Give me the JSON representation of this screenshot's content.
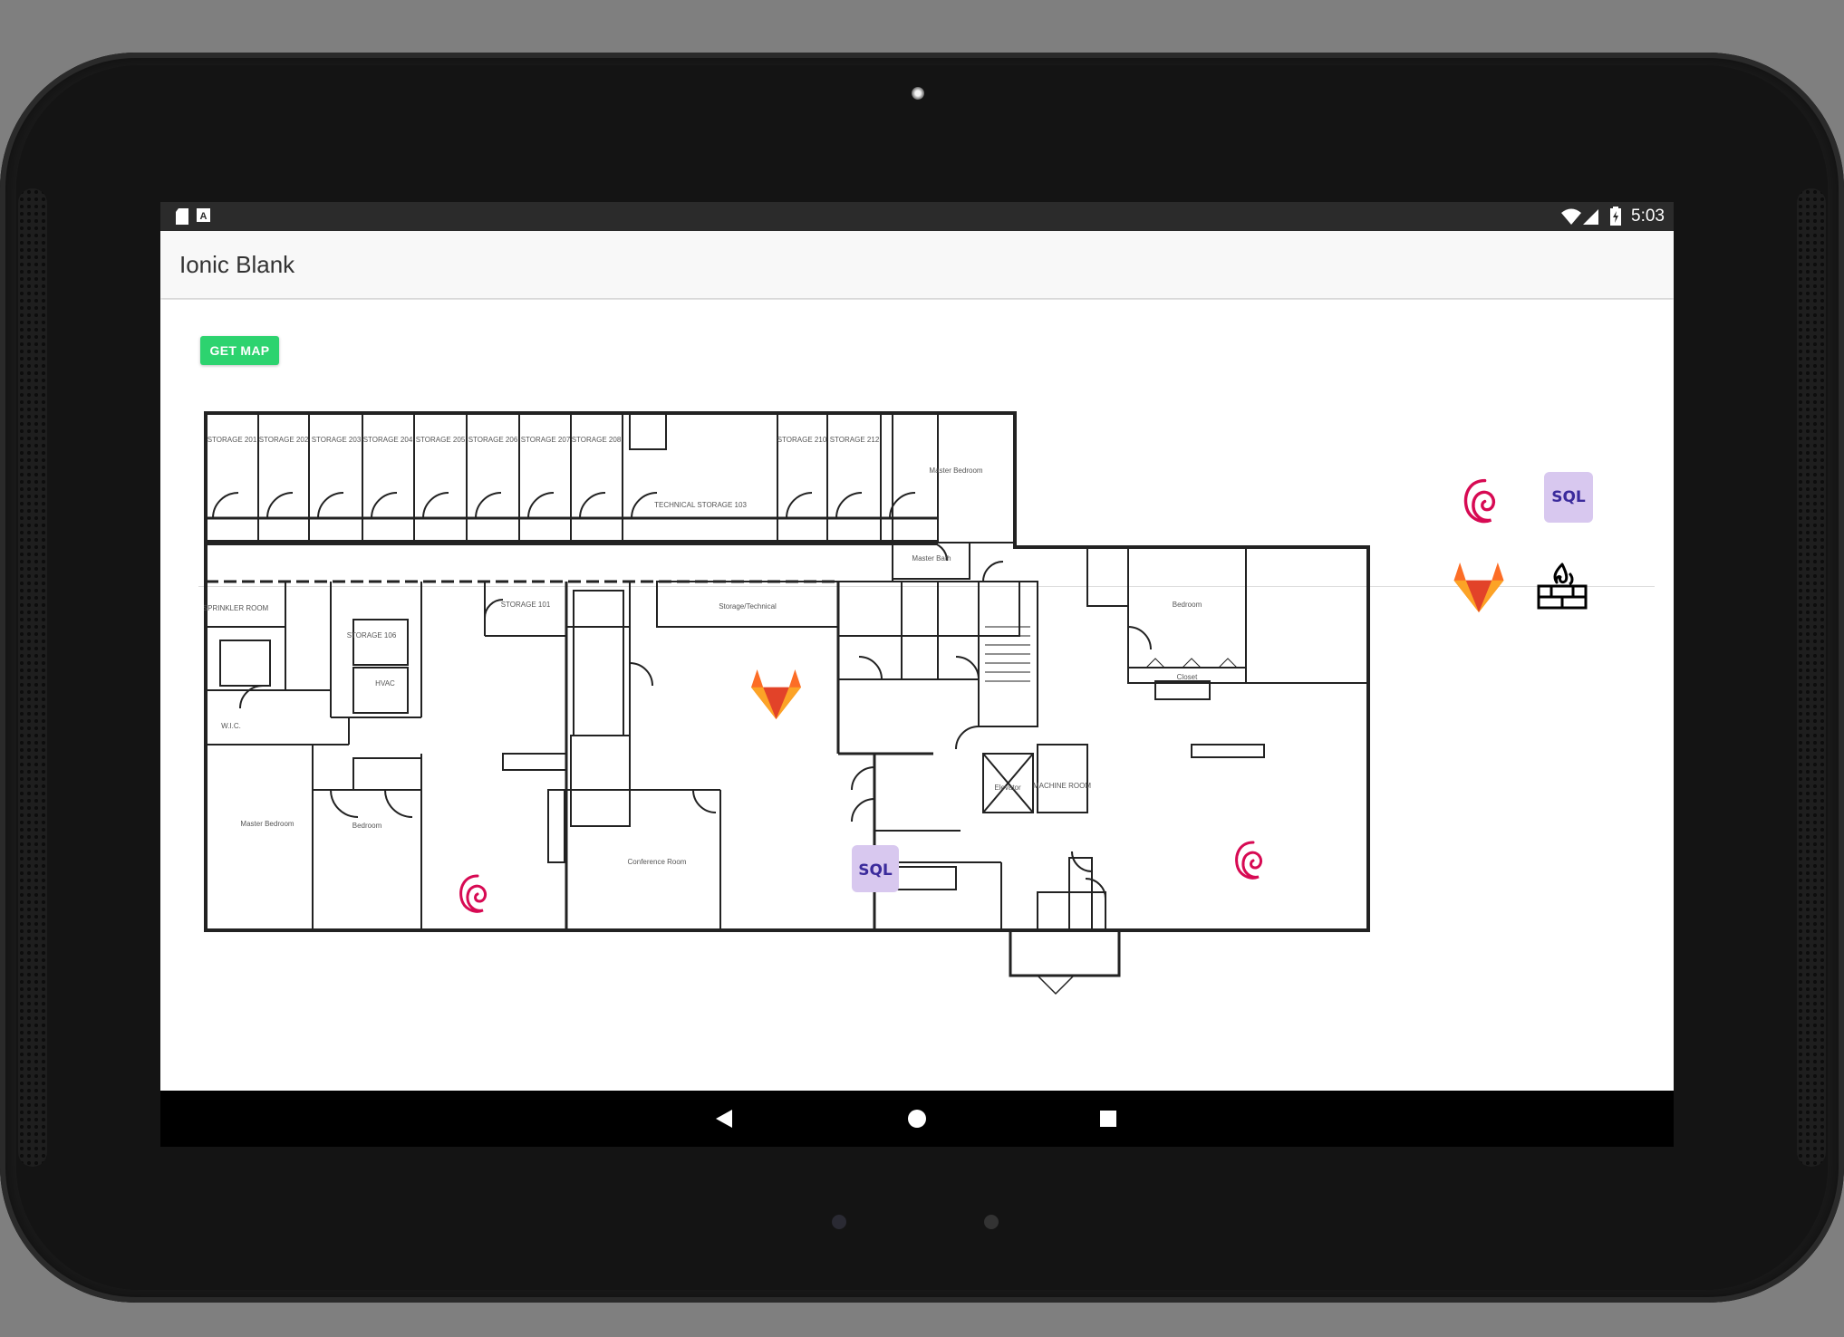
{
  "status_bar": {
    "left_icons": [
      "sd-card-icon",
      "a-notification-icon"
    ],
    "right_icons": [
      "wifi-icon",
      "cell-signal-icon",
      "battery-icon"
    ],
    "time": "5:03"
  },
  "header": {
    "title": "Ionic Blank"
  },
  "content": {
    "get_map_label": "GET MAP"
  },
  "floor_plan": {
    "room_labels": {
      "storage_201": "STORAGE 201",
      "storage_202": "STORAGE 202",
      "storage_203": "STORAGE 203",
      "storage_204": "STORAGE 204",
      "storage_205": "STORAGE 205",
      "storage_206": "STORAGE 206",
      "storage_207": "STORAGE 207",
      "storage_208": "STORAGE 208",
      "storage_210": "STORAGE 210",
      "storage_212": "STORAGE 212",
      "technical_storage": "TECHNICAL STORAGE 103",
      "master_bedroom_top": "Master Bedroom",
      "master_bath": "Master Bath",
      "sprinkler_room": "SPRINKLER ROOM",
      "storage_106": "STORAGE 106",
      "storage_101": "STORAGE 101",
      "storage_technical": "Storage/Technical",
      "wic": "W.I.C.",
      "hvac": "HVAC",
      "master_bedroom_left": "Master Bedroom",
      "bedroom_left": "Bedroom",
      "conference_room": "Conference Room",
      "elevator": "Elevator",
      "machine_room": "MACHINE ROOM",
      "bedroom_right": "Bedroom",
      "closet": "Closet"
    },
    "placed_icons": [
      {
        "name": "gitlab-icon"
      },
      {
        "name": "debian-icon"
      },
      {
        "name": "sql-icon",
        "label": "SQL"
      },
      {
        "name": "debian-icon"
      }
    ]
  },
  "legend": {
    "items": [
      {
        "name": "debian-icon"
      },
      {
        "name": "sql-icon",
        "label": "SQL"
      },
      {
        "name": "gitlab-icon"
      },
      {
        "name": "firewall-icon"
      }
    ]
  },
  "nav_bar": {
    "buttons": [
      "back-icon",
      "home-icon",
      "recents-icon"
    ]
  },
  "colors": {
    "button": "#2dd36f",
    "sql_bg": "#d8c8ef",
    "sql_text": "#3b2b9c",
    "debian": "#d70a53",
    "gitlab_orange": "#fc6d26",
    "gitlab_red": "#e24329"
  }
}
